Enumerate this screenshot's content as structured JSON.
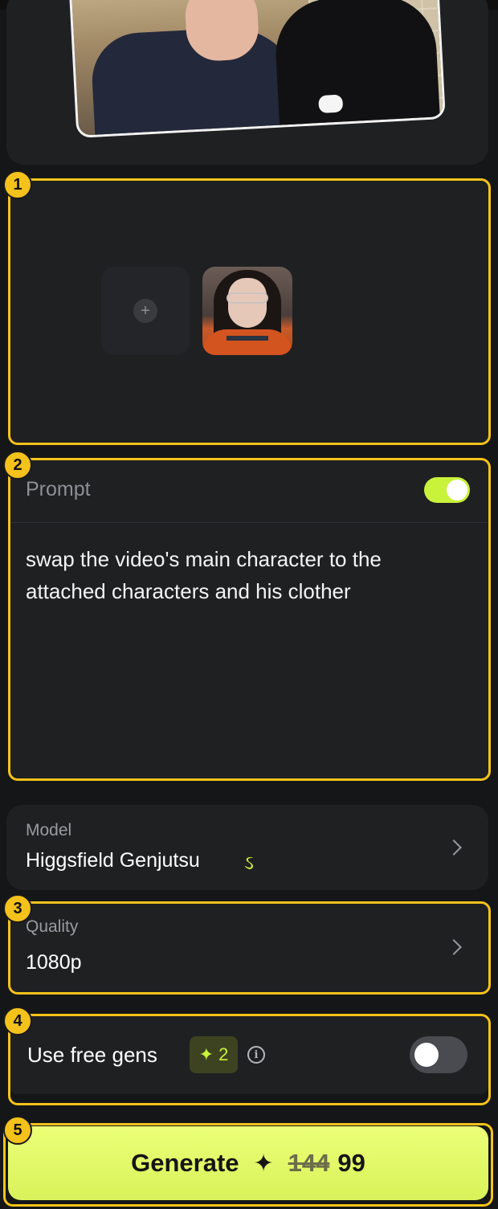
{
  "video": {},
  "markers": [
    "1",
    "2",
    "3",
    "4",
    "5"
  ],
  "characters": {
    "add_icon": "plus-icon"
  },
  "prompt": {
    "label": "Prompt",
    "enabled": true,
    "text": "swap the video's main character to the attached characters and his clother"
  },
  "model": {
    "label": "Model",
    "value": "Higgsfield Genjutsu",
    "icon": "genjutsu-squiggle-icon"
  },
  "quality": {
    "label": "Quality",
    "value": "1080p"
  },
  "free_gens": {
    "label": "Use free gens",
    "count": "2",
    "enabled": false
  },
  "generate": {
    "label": "Generate",
    "old_cost": "144",
    "cost": "99"
  },
  "colors": {
    "accent": "#c9f23b",
    "highlight": "#f4c21a",
    "card": "#1f2022",
    "background": "#151618"
  }
}
